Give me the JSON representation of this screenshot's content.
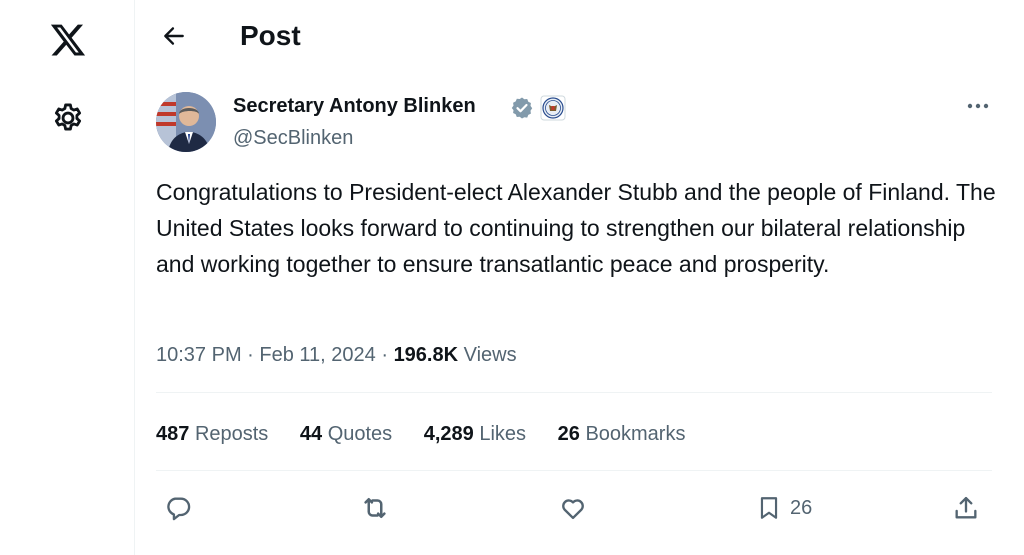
{
  "header": {
    "title": "Post"
  },
  "author": {
    "name": "Secretary Antony Blinken",
    "handle": "@SecBlinken"
  },
  "post": {
    "text": "Congratulations to President-elect Alexander Stubb and the people of Finland. The United States looks forward to continuing to strengthen our bilateral relationship and working together to ensure transatlantic peace and prosperity.",
    "time": "10:37 PM",
    "date": "Feb 11, 2024",
    "views_count": "196.8K",
    "views_label": "Views"
  },
  "stats": [
    {
      "num": "487",
      "label": "Reposts"
    },
    {
      "num": "44",
      "label": "Quotes"
    },
    {
      "num": "4,289",
      "label": "Likes"
    },
    {
      "num": "26",
      "label": "Bookmarks"
    }
  ],
  "actions": {
    "bookmark_count": "26"
  },
  "colors": {
    "text": "#0f1419",
    "muted": "#536471",
    "verified": "#829aab",
    "divider": "#eff3f4"
  },
  "icons": [
    "x-logo-icon",
    "gear-icon",
    "back-arrow-icon",
    "verified-badge-icon",
    "government-seal-icon",
    "more-icon",
    "reply-icon",
    "repost-icon",
    "like-icon",
    "bookmark-icon",
    "share-icon"
  ]
}
